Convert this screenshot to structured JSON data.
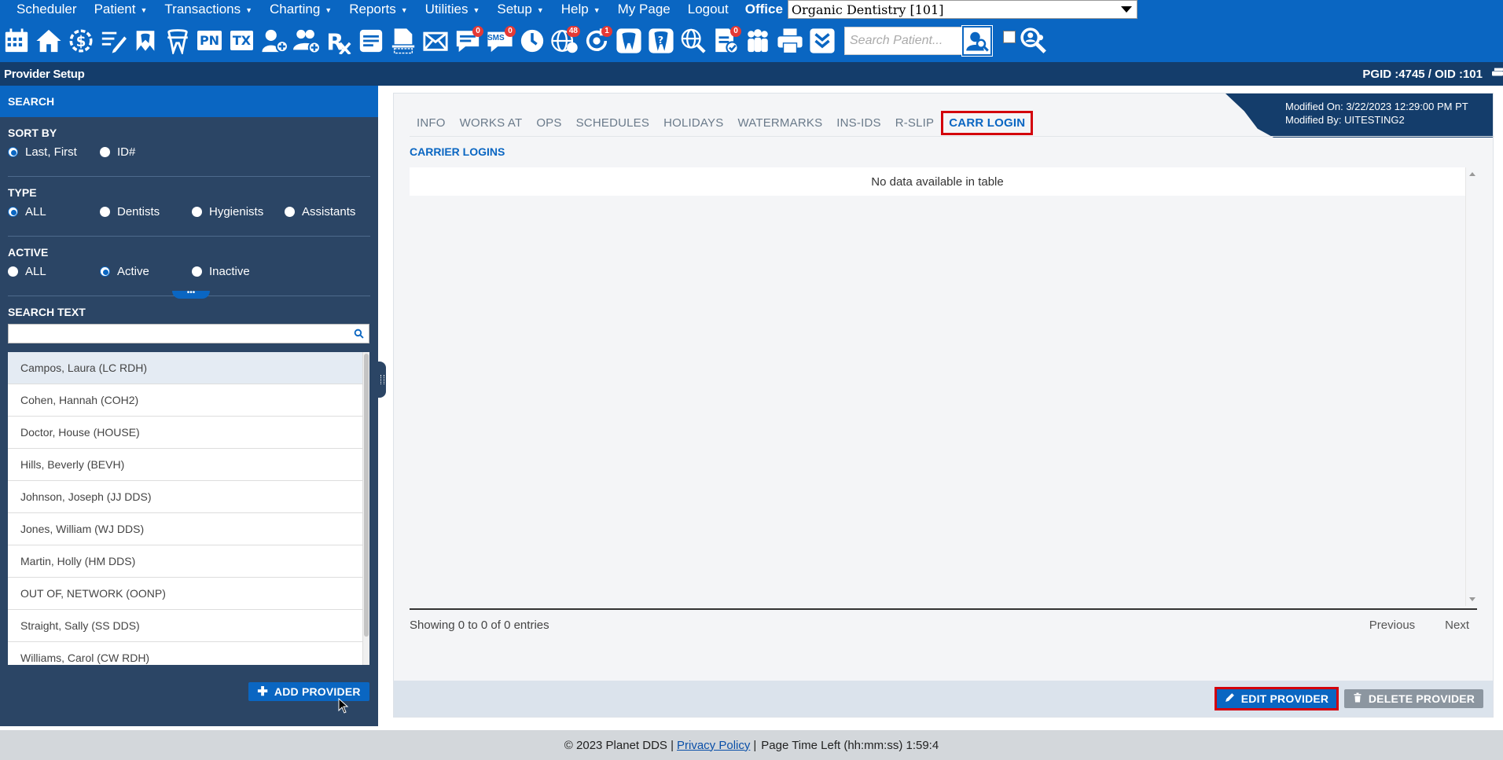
{
  "top_menu": {
    "items": [
      {
        "label": "Scheduler",
        "caret": false
      },
      {
        "label": "Patient",
        "caret": true
      },
      {
        "label": "Transactions",
        "caret": true
      },
      {
        "label": "Charting",
        "caret": true
      },
      {
        "label": "Reports",
        "caret": true
      },
      {
        "label": "Utilities",
        "caret": true
      },
      {
        "label": "Setup",
        "caret": true
      },
      {
        "label": "Help",
        "caret": true
      },
      {
        "label": "My Page",
        "caret": false
      },
      {
        "label": "Logout",
        "caret": false
      }
    ],
    "office_label": "Office",
    "office_value": "Organic Dentistry [101]"
  },
  "toolbar": {
    "badges": {
      "messages": "0",
      "sms": "0",
      "web": "48",
      "recall": "1",
      "forms": "0"
    },
    "sms_text": "SMS",
    "pn_text": "PN",
    "tx_text": "TX",
    "search_placeholder": "Search Patient..."
  },
  "titlebar": {
    "title": "Provider Setup",
    "ids": "PGID :4745  /  OID :101"
  },
  "sidebar": {
    "header": "SEARCH",
    "sort_by": {
      "label": "SORT BY",
      "options": [
        "Last, First",
        "ID#"
      ],
      "selected": "Last, First"
    },
    "type": {
      "label": "TYPE",
      "options": [
        "ALL",
        "Dentists",
        "Hygienists",
        "Assistants"
      ],
      "selected": "ALL"
    },
    "active": {
      "label": "ACTIVE",
      "options": [
        "ALL",
        "Active",
        "Inactive"
      ],
      "selected": "Active"
    },
    "collapse_glyph": "•••",
    "search_text_label": "SEARCH TEXT",
    "search_text_value": "",
    "providers": [
      "Campos, Laura (LC RDH)",
      "Cohen, Hannah (COH2)",
      "Doctor, House (HOUSE)",
      "Hills, Beverly (BEVH)",
      "Johnson, Joseph (JJ DDS)",
      "Jones, William (WJ DDS)",
      "Martin, Holly (HM DDS)",
      "OUT OF, NETWORK (OONP)",
      "Straight, Sally (SS DDS)",
      "Williams, Carol (CW RDH)"
    ],
    "selected_provider": "Campos, Laura (LC RDH)",
    "add_button": "ADD PROVIDER"
  },
  "main": {
    "modified_on": "Modified On: 3/22/2023 12:29:00 PM PT",
    "modified_by": "Modified By: UITESTING2",
    "tabs": [
      "INFO",
      "WORKS AT",
      "OPS",
      "SCHEDULES",
      "HOLIDAYS",
      "WATERMARKS",
      "INS-IDS",
      "R-SLIP",
      "CARR LOGIN"
    ],
    "active_tab": "CARR LOGIN",
    "section_title": "CARRIER LOGINS",
    "empty_text": "No data available in table",
    "info_text": "Showing 0 to 0 of 0 entries",
    "pager": {
      "previous": "Previous",
      "next": "Next"
    },
    "edit_button": "EDIT PROVIDER",
    "delete_button": "DELETE PROVIDER"
  },
  "footer": {
    "copyright": "© 2023 Planet DDS |",
    "privacy": "Privacy Policy",
    "separator": "|",
    "time_left": "Page Time Left (hh:mm:ss) 1:59:4"
  },
  "colors": {
    "primary": "#0a66c2",
    "navy": "#143d6b",
    "sidebar": "#2b4565",
    "highlight_red": "#d3000b"
  }
}
